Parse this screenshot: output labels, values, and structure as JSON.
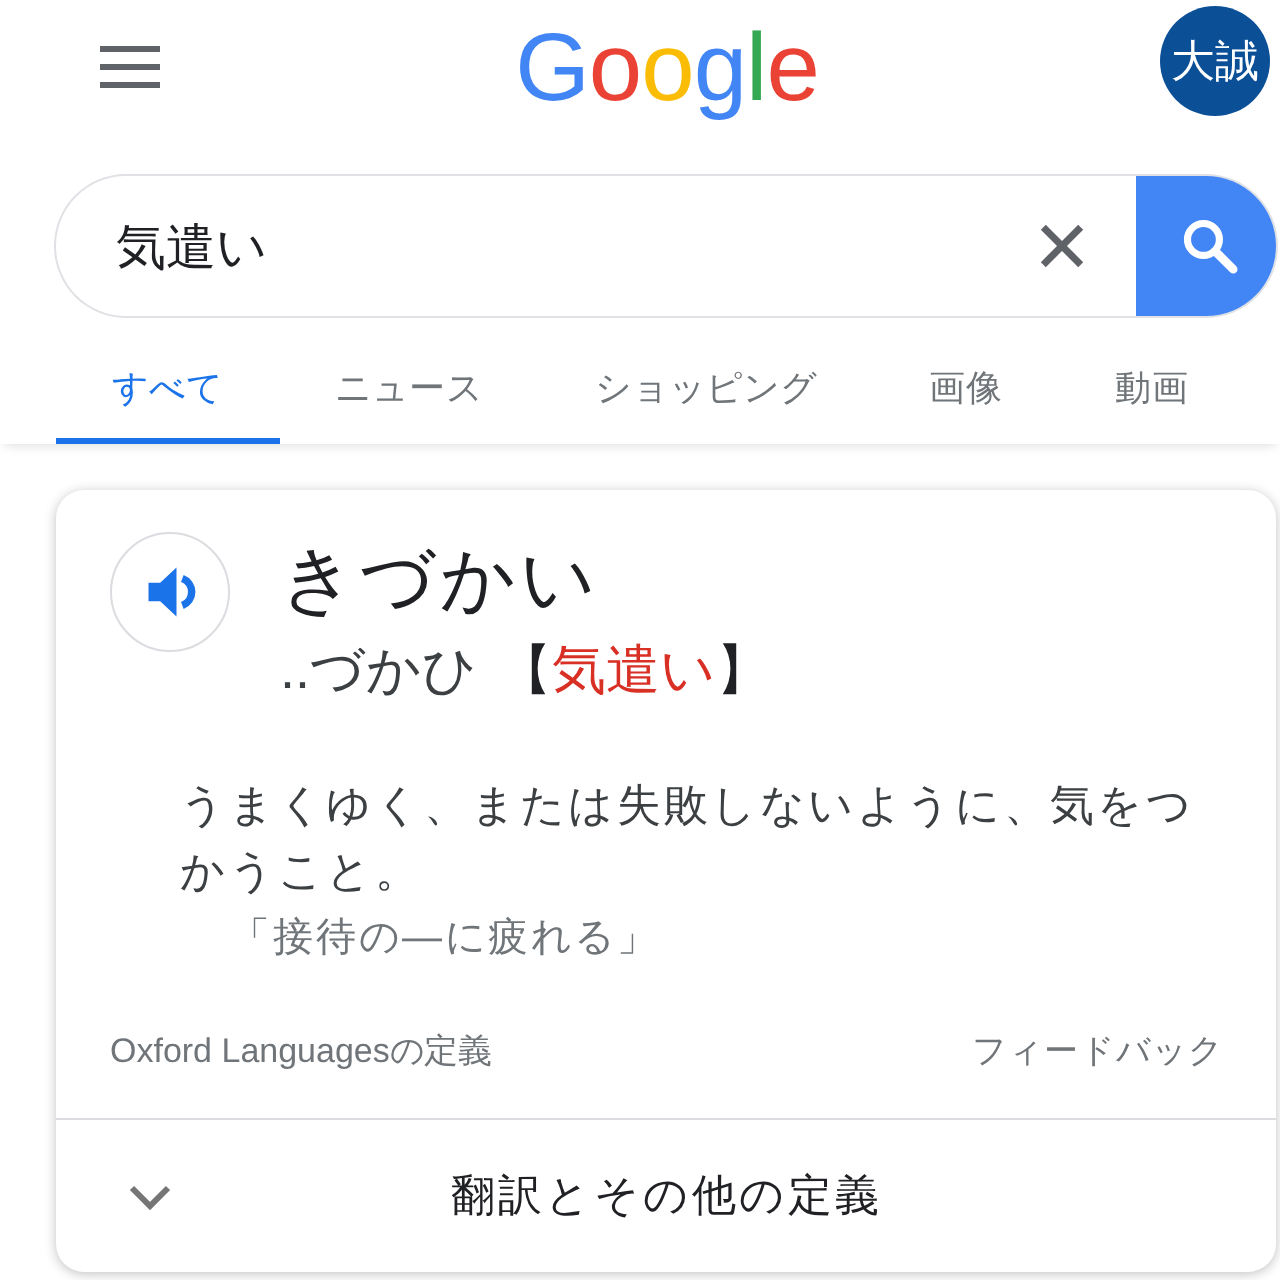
{
  "header": {
    "logo": "Google",
    "account": {
      "initials": "大誠"
    }
  },
  "search": {
    "value": "気遣い"
  },
  "tabs": [
    {
      "label": "すべて",
      "selected": true
    },
    {
      "label": "ニュース",
      "selected": false
    },
    {
      "label": "ショッピング",
      "selected": false
    },
    {
      "label": "画像",
      "selected": false
    },
    {
      "label": "動画",
      "selected": false
    }
  ],
  "dictionary": {
    "headword": "きづかい",
    "reading": "..づかひ",
    "notation": {
      "open": "【",
      "word": "気遣い",
      "close": "】"
    },
    "definitions": [
      {
        "text": "うまくゆく、または失敗しないように、気をつかうこと。",
        "example": "「接待の―に疲れる」"
      }
    ],
    "source": "Oxford Languagesの定義",
    "feedback": "フィードバック"
  },
  "more": {
    "label": "翻訳とその他の定義",
    "expanded": false
  }
}
